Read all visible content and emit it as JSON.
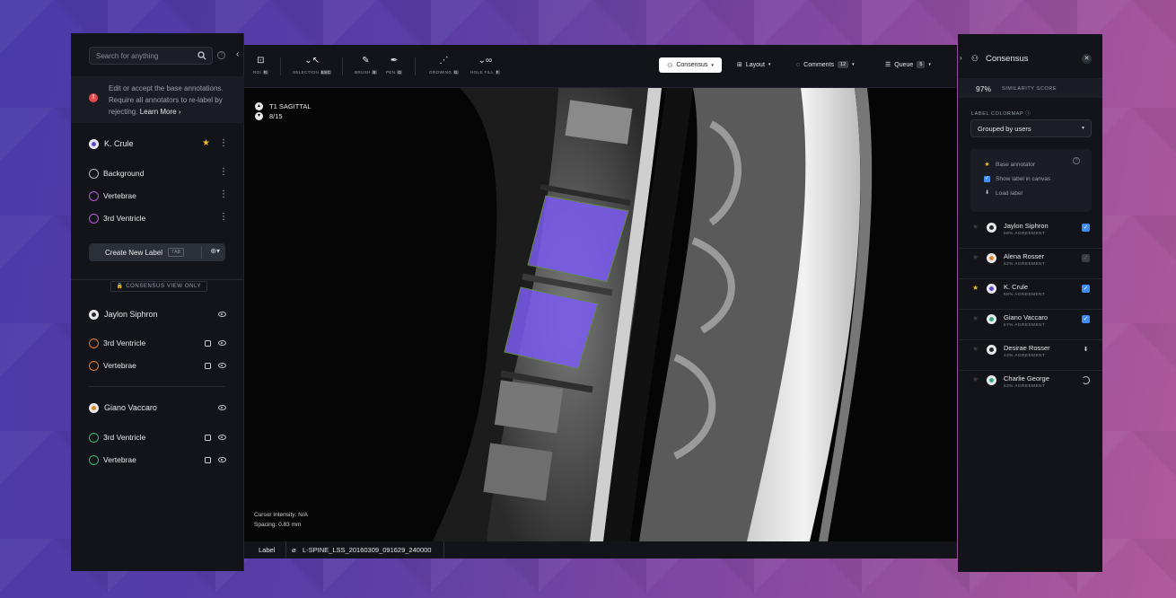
{
  "left_panel": {
    "search_placeholder": "Search for anything",
    "notice": {
      "text": "Edit or accept the base annotations. Require all annotators to re-label by rejecting.",
      "link": "Learn More"
    },
    "current_user": {
      "name": "K. Crule",
      "labels": [
        "Background",
        "Vertebrae",
        "3rd Ventricle"
      ]
    },
    "create_label": {
      "label": "Create New Label",
      "shortcut": "TAB"
    },
    "consensus_badge": "CONSENSUS VIEW ONLY",
    "groups": [
      {
        "name": "Jaylon Siphron",
        "labels": [
          "3rd Ventricle",
          "Vertebrae"
        ]
      },
      {
        "name": "Giano Vaccaro",
        "labels": [
          "3rd Ventricle",
          "Vertebrae"
        ]
      }
    ]
  },
  "toolbar": {
    "tools": [
      {
        "label": "ROI",
        "key": "R"
      },
      {
        "label": "SELECTION",
        "key": "ESC"
      },
      {
        "label": "BRUSH",
        "key": "B"
      },
      {
        "label": "PEN",
        "key": "G"
      },
      {
        "label": "GROWING",
        "key": "G"
      },
      {
        "label": "HOLE FILL",
        "key": "F"
      }
    ],
    "consensus": "Consensus",
    "layout": "Layout",
    "comments": "Comments",
    "comments_count": "12",
    "queue": "Queue",
    "queue_count": "5"
  },
  "viewer": {
    "series": "T1 SAGITTAL",
    "slice": "8/15",
    "cursor_intensity": "Cursor Intensity: N/A",
    "spacing": "Spacing: 0.83 mm"
  },
  "footer": {
    "label_tab": "Label",
    "file": "L-SPINE_LSS_20160309_091629_240000"
  },
  "right_panel": {
    "title": "Consensus",
    "similarity_value": "97%",
    "similarity_label": "SIMILARITY SCORE",
    "colormap_label": "LABEL COLORMAP",
    "colormap_value": "Grouped by users",
    "options": [
      "Base annotator",
      "Show label in canvas",
      "Load label"
    ],
    "annotators": [
      {
        "name": "Jaylon Siphron",
        "agreement": "58% AGREEMENT",
        "starred": false,
        "state": "checked"
      },
      {
        "name": "Alena Rosser",
        "agreement": "62% AGREEMENT",
        "starred": false,
        "state": "disabled"
      },
      {
        "name": "K. Crule",
        "agreement": "68% AGREEMENT",
        "starred": true,
        "state": "checked"
      },
      {
        "name": "Giano Vaccaro",
        "agreement": "57% AGREEMENT",
        "starred": false,
        "state": "checked"
      },
      {
        "name": "Desirae Rosser",
        "agreement": "43% AGREEMENT",
        "starred": false,
        "state": "download"
      },
      {
        "name": "Charlie George",
        "agreement": "63% AGREEMENT",
        "starred": false,
        "state": "loading"
      }
    ]
  },
  "colors": {
    "accent_blue": "#3e8ef7",
    "star": "#f5b92e",
    "warning": "#e5484d",
    "segmentation": "#7a5cf0"
  }
}
